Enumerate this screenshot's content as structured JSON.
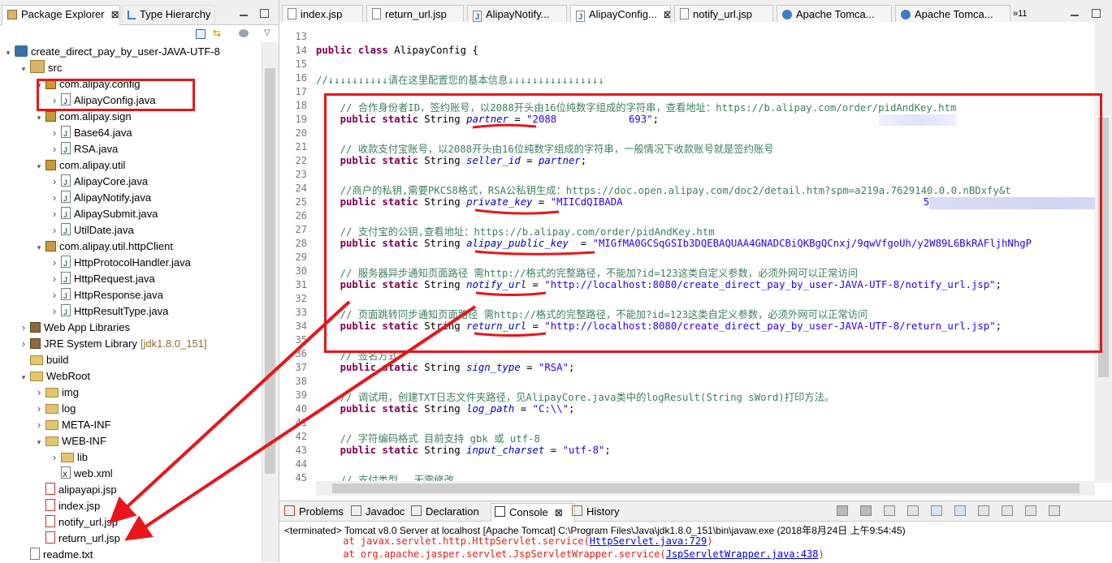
{
  "left_panel": {
    "tabs": [
      {
        "label": "Package Explorer",
        "close": "⊠"
      },
      {
        "label": "Type Hierarchy"
      }
    ],
    "tree": [
      {
        "label": "create_direct_pay_by_user-JAVA-UTF-8",
        "depth": 0,
        "twisty": "open",
        "icon": "project"
      },
      {
        "label": "src",
        "depth": 1,
        "twisty": "open",
        "icon": "srcfolder"
      },
      {
        "label": "com.alipay.config",
        "depth": 2,
        "twisty": "open",
        "icon": "package"
      },
      {
        "label": "AlipayConfig.java",
        "depth": 3,
        "twisty": "closed",
        "icon": "java",
        "selected": true
      },
      {
        "label": "com.alipay.sign",
        "depth": 2,
        "twisty": "open",
        "icon": "package"
      },
      {
        "label": "Base64.java",
        "depth": 3,
        "twisty": "closed",
        "icon": "java"
      },
      {
        "label": "RSA.java",
        "depth": 3,
        "twisty": "closed",
        "icon": "java"
      },
      {
        "label": "com.alipay.util",
        "depth": 2,
        "twisty": "open",
        "icon": "package"
      },
      {
        "label": "AlipayCore.java",
        "depth": 3,
        "twisty": "closed",
        "icon": "java"
      },
      {
        "label": "AlipayNotify.java",
        "depth": 3,
        "twisty": "closed",
        "icon": "java"
      },
      {
        "label": "AlipaySubmit.java",
        "depth": 3,
        "twisty": "closed",
        "icon": "java"
      },
      {
        "label": "UtilDate.java",
        "depth": 3,
        "twisty": "closed",
        "icon": "java"
      },
      {
        "label": "com.alipay.util.httpClient",
        "depth": 2,
        "twisty": "open",
        "icon": "package"
      },
      {
        "label": "HttpProtocolHandler.java",
        "depth": 3,
        "twisty": "closed",
        "icon": "java"
      },
      {
        "label": "HttpRequest.java",
        "depth": 3,
        "twisty": "closed",
        "icon": "java"
      },
      {
        "label": "HttpResponse.java",
        "depth": 3,
        "twisty": "closed",
        "icon": "java"
      },
      {
        "label": "HttpResultType.java",
        "depth": 3,
        "twisty": "closed",
        "icon": "java"
      },
      {
        "label": "Web App Libraries",
        "depth": 1,
        "twisty": "closed",
        "icon": "library"
      },
      {
        "label": "JRE System Library",
        "suffix": "[jdk1.8.0_151]",
        "depth": 1,
        "twisty": "closed",
        "icon": "library"
      },
      {
        "label": "build",
        "depth": 1,
        "twisty": "none",
        "icon": "folder"
      },
      {
        "label": "WebRoot",
        "depth": 1,
        "twisty": "open",
        "icon": "webroot"
      },
      {
        "label": "img",
        "depth": 2,
        "twisty": "closed",
        "icon": "folder"
      },
      {
        "label": "log",
        "depth": 2,
        "twisty": "closed",
        "icon": "folder"
      },
      {
        "label": "META-INF",
        "depth": 2,
        "twisty": "closed",
        "icon": "folder"
      },
      {
        "label": "WEB-INF",
        "depth": 2,
        "twisty": "open",
        "icon": "folder"
      },
      {
        "label": "lib",
        "depth": 3,
        "twisty": "closed",
        "icon": "folder"
      },
      {
        "label": "web.xml",
        "depth": 3,
        "twisty": "none",
        "icon": "xml"
      },
      {
        "label": "alipayapi.jsp",
        "depth": 2,
        "twisty": "none",
        "icon": "jsp"
      },
      {
        "label": "index.jsp",
        "depth": 2,
        "twisty": "none",
        "icon": "jsp"
      },
      {
        "label": "notify_url.jsp",
        "depth": 2,
        "twisty": "none",
        "icon": "jsp"
      },
      {
        "label": "return_url.jsp",
        "depth": 2,
        "twisty": "none",
        "icon": "jsp"
      },
      {
        "label": "readme.txt",
        "depth": 1,
        "twisty": "none",
        "icon": "txt"
      }
    ]
  },
  "editor": {
    "tabs": [
      {
        "label": "index.jsp",
        "icon": "jsp"
      },
      {
        "label": "return_url.jsp",
        "icon": "jsp"
      },
      {
        "label": "AlipayNotify...",
        "icon": "java"
      },
      {
        "label": "AlipayConfig...",
        "icon": "java",
        "active": true,
        "close": "⊠"
      },
      {
        "label": "notify_url.jsp",
        "icon": "jsp"
      },
      {
        "label": "Apache Tomca...",
        "icon": "globe"
      },
      {
        "label": "Apache Tomca...",
        "icon": "globe"
      }
    ],
    "overflow_label": "»11",
    "lines": [
      {
        "n": "13",
        "segs": []
      },
      {
        "n": "14",
        "segs": [
          [
            "kw",
            "public class "
          ],
          [
            "",
            "AlipayConfig {"
          ]
        ]
      },
      {
        "n": "15",
        "segs": []
      },
      {
        "n": "16",
        "segs": [
          [
            "cm",
            "//↓↓↓↓↓↓↓↓↓↓请在这里配置您的基本信息↓↓↓↓↓↓↓↓↓↓↓↓↓↓↓↓"
          ]
        ]
      },
      {
        "n": "17",
        "segs": []
      },
      {
        "n": "18",
        "segs": [
          [
            "cm",
            "    // 合作身份者ID，签约账号，以2088开头由16位纯数字组成的字符串，查看地址：https://b.alipay.com/order/pidAndKey.htm"
          ]
        ]
      },
      {
        "n": "19",
        "segs": [
          [
            "kw",
            "    public static "
          ],
          [
            "",
            "String "
          ],
          [
            "fd",
            "partner"
          ],
          [
            "",
            " = "
          ],
          [
            "st",
            "\"2088            693\""
          ],
          [
            "",
            ";"
          ]
        ]
      },
      {
        "n": "20",
        "segs": []
      },
      {
        "n": "21",
        "segs": [
          [
            "cm",
            "    // 收款支付宝账号，以2088开头由16位纯数字组成的字符串，一般情况下收款账号就是签约账号"
          ]
        ]
      },
      {
        "n": "22",
        "segs": [
          [
            "kw",
            "    public static "
          ],
          [
            "",
            "String "
          ],
          [
            "fd",
            "seller_id"
          ],
          [
            "",
            " = "
          ],
          [
            "fd",
            "partner"
          ],
          [
            "",
            ";"
          ]
        ]
      },
      {
        "n": "23",
        "segs": []
      },
      {
        "n": "24",
        "segs": [
          [
            "cm",
            "    //商户的私钥,需要PKCS8格式，RSA公私钥生成：https://doc.open.alipay.com/doc2/detail.htm?spm=a219a.7629140.0.0.nBDxfy&t"
          ]
        ]
      },
      {
        "n": "25",
        "segs": [
          [
            "kw",
            "    public static "
          ],
          [
            "",
            "String "
          ],
          [
            "fd",
            "private_key"
          ],
          [
            "",
            " = "
          ],
          [
            "st",
            "\"MIICdQIBADA                                                  5UcFgI4hRc"
          ]
        ]
      },
      {
        "n": "26",
        "segs": []
      },
      {
        "n": "27",
        "segs": [
          [
            "cm",
            "    // 支付宝的公钥,查看地址：https://b.alipay.com/order/pidAndKey.htm"
          ]
        ]
      },
      {
        "n": "28",
        "segs": [
          [
            "kw",
            "    public static "
          ],
          [
            "",
            "String "
          ],
          [
            "fd",
            "alipay_public_key"
          ],
          [
            "",
            "  = "
          ],
          [
            "st",
            "\"MIGfMA0GCSqGSIb3DQEBAQUAA4GNADCBiQKBgQCnxj/9qwVfgoUh/y2W89L6BkRAFljhNhgP"
          ]
        ]
      },
      {
        "n": "29",
        "segs": []
      },
      {
        "n": "30",
        "segs": [
          [
            "cm",
            "    // 服务器异步通知页面路径 需http://格式的完整路径，不能加?id=123这类自定义参数，必须外网可以正常访问"
          ]
        ]
      },
      {
        "n": "31",
        "segs": [
          [
            "kw",
            "    public static "
          ],
          [
            "",
            "String "
          ],
          [
            "fd",
            "notify_url"
          ],
          [
            "",
            " = "
          ],
          [
            "st",
            "\"http://localhost:8080/create_direct_pay_by_user-JAVA-UTF-8/notify_url.jsp\""
          ],
          [
            "",
            ";"
          ]
        ]
      },
      {
        "n": "32",
        "segs": []
      },
      {
        "n": "33",
        "segs": [
          [
            "cm",
            "    // 页面跳转同步通知页面路径 需http://格式的完整路径，不能加?id=123这类自定义参数，必须外网可以正常访问"
          ]
        ]
      },
      {
        "n": "34",
        "segs": [
          [
            "kw",
            "    public static "
          ],
          [
            "",
            "String "
          ],
          [
            "fd",
            "return_url"
          ],
          [
            "",
            " = "
          ],
          [
            "st",
            "\"http://localhost:8080/create_direct_pay_by_user-JAVA-UTF-8/return_url.jsp\""
          ],
          [
            "",
            ";"
          ]
        ]
      },
      {
        "n": "35",
        "segs": []
      },
      {
        "n": "36",
        "segs": [
          [
            "cm",
            "    // 签名方式"
          ]
        ]
      },
      {
        "n": "37",
        "segs": [
          [
            "kw",
            "    public static "
          ],
          [
            "",
            "String "
          ],
          [
            "fd",
            "sign_type"
          ],
          [
            "",
            " = "
          ],
          [
            "st",
            "\"RSA\""
          ],
          [
            "",
            ";"
          ]
        ]
      },
      {
        "n": "38",
        "segs": []
      },
      {
        "n": "39",
        "segs": [
          [
            "cm",
            "    // 调试用，创建TXT日志文件夹路径，见AlipayCore.java类中的logResult(String sWord)打印方法。"
          ]
        ]
      },
      {
        "n": "40",
        "segs": [
          [
            "kw",
            "    public static "
          ],
          [
            "",
            "String "
          ],
          [
            "fd",
            "log_path"
          ],
          [
            "",
            " = "
          ],
          [
            "st",
            "\"C:\\\\\""
          ],
          [
            "",
            ";"
          ]
        ]
      },
      {
        "n": "41",
        "segs": []
      },
      {
        "n": "42",
        "segs": [
          [
            "cm",
            "    // 字符编码格式 目前支持 gbk 或 utf-8"
          ]
        ]
      },
      {
        "n": "43",
        "segs": [
          [
            "kw",
            "    public static "
          ],
          [
            "",
            "String "
          ],
          [
            "fd",
            "input_charset"
          ],
          [
            "",
            " = "
          ],
          [
            "st",
            "\"utf-8\""
          ],
          [
            "",
            ";"
          ]
        ]
      },
      {
        "n": "44",
        "segs": []
      },
      {
        "n": "45",
        "segs": [
          [
            "cm",
            "    // 支付类型 ，无需修改"
          ]
        ]
      }
    ]
  },
  "console": {
    "tabs": [
      {
        "label": "Problems",
        "icon": "problems"
      },
      {
        "label": "Javadoc",
        "icon": "javadoc"
      },
      {
        "label": "Declaration",
        "icon": "declaration"
      },
      {
        "label": "Console",
        "icon": "console",
        "active": true,
        "close": "⊠"
      },
      {
        "label": "History",
        "icon": "history"
      }
    ],
    "status": "<terminated> Tomcat v8.0 Server at localhost [Apache Tomcat] C:\\Program Files\\Java\\jdk1.8.0_151\\bin\\javaw.exe (2018年8月24日 上午9:54:45)",
    "lines": [
      {
        "prefix": "\tat javax.servlet.http.HttpServlet.service(",
        "link": "HttpServlet.java:729",
        "suffix": ")"
      },
      {
        "prefix": "\tat org.apache.jasper.servlet.JspServletWrapper.service(",
        "link": "JspServletWrapper.java:438",
        "suffix": ")"
      }
    ]
  },
  "colors": {
    "annotation_red": "#e8151b",
    "keyword": "#7f0055",
    "comment": "#3f7f5f",
    "string": "#2a00ff",
    "field": "#0000c0"
  }
}
